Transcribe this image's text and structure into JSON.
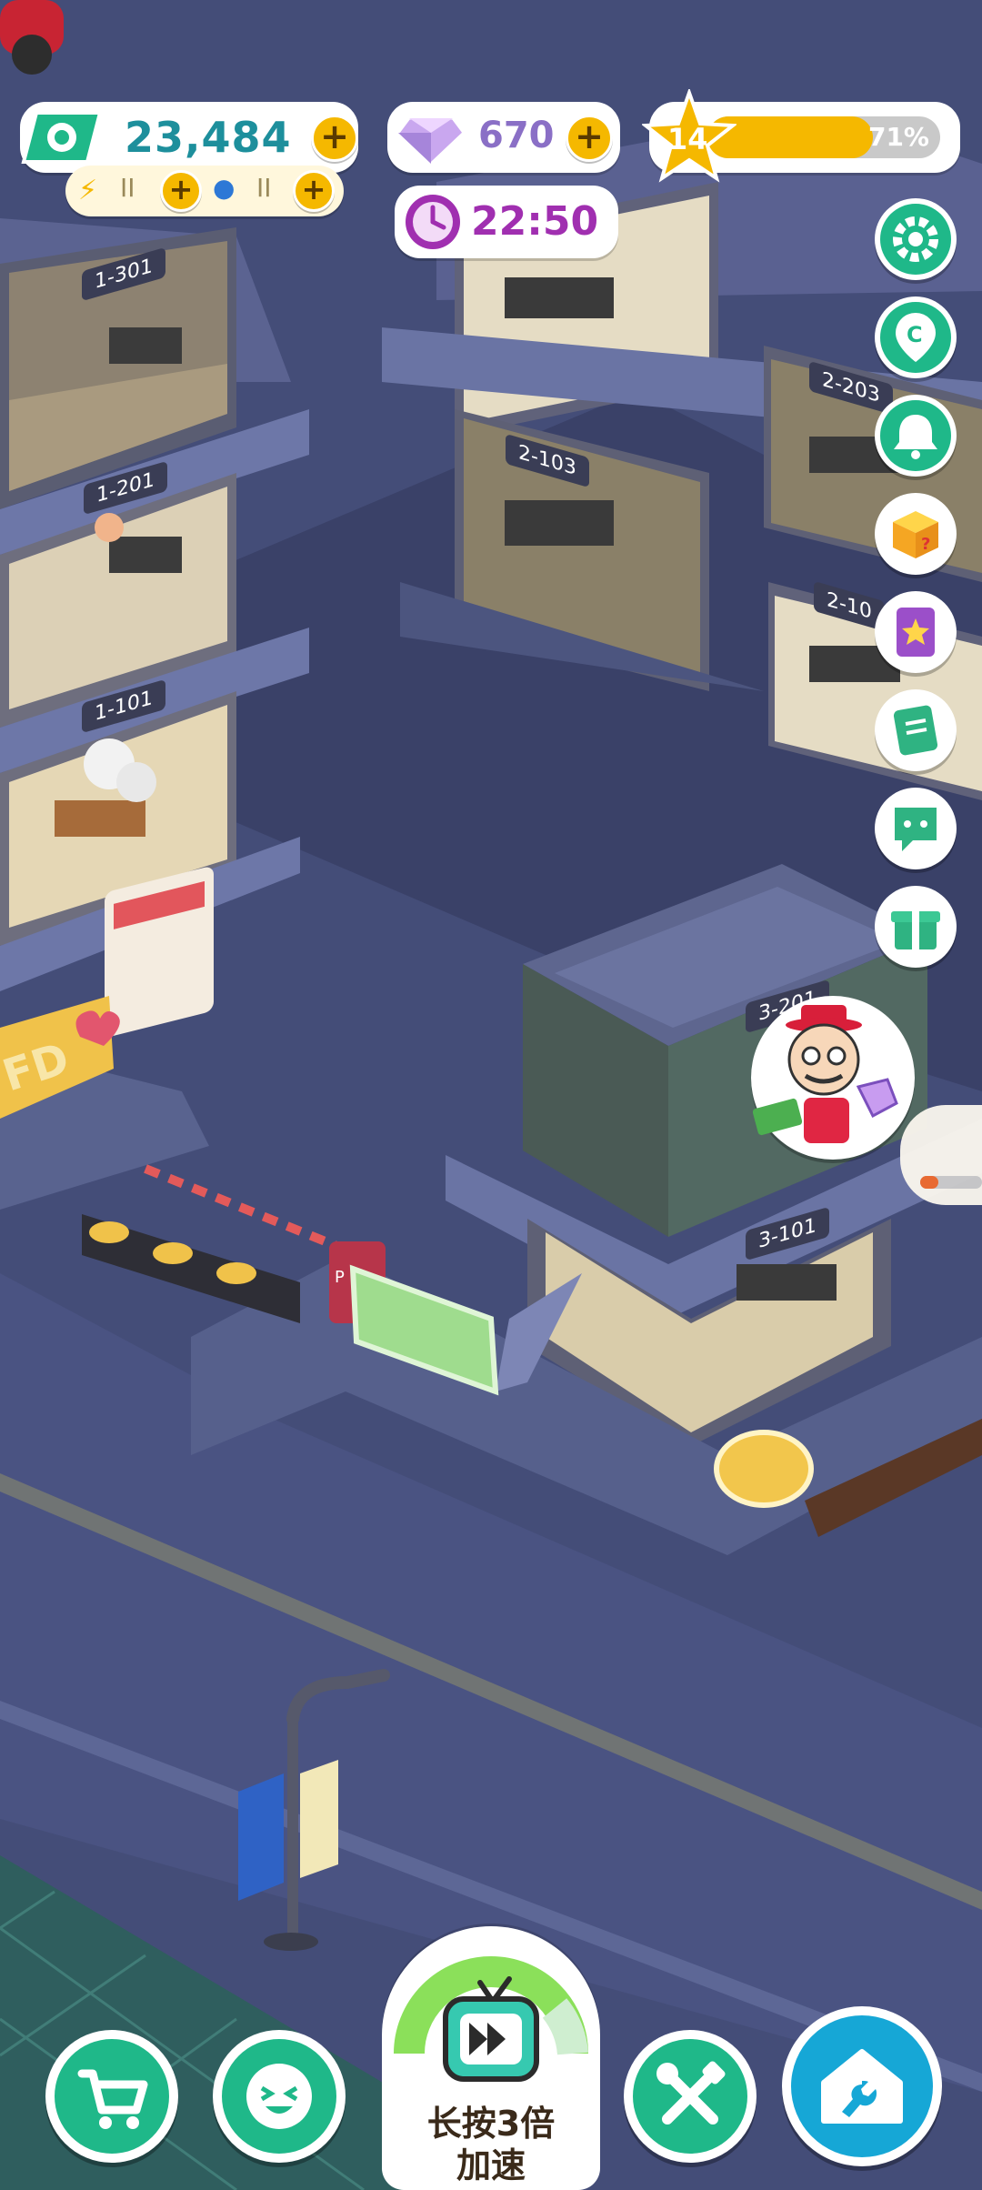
{
  "hud": {
    "cash": "23,484",
    "gems": "670",
    "level": "14",
    "level_progress_text": "71%",
    "level_progress": 0.71,
    "clock": "22:50",
    "energy_bar_text": "II",
    "water_bar_text": "II"
  },
  "rooms": {
    "r1_301": "1-301",
    "r1_201": "1-201",
    "r1_101": "1-101",
    "r2_103": "2-103",
    "r2_203": "2-203",
    "r2_10x": "2-10",
    "r3_201": "3-201",
    "r3_101": "3-101"
  },
  "signs": {
    "billboard": "FD",
    "parking": "P"
  },
  "speed_button": {
    "line1": "长按3倍",
    "line2": "加速"
  },
  "side_icons": [
    "gear-icon",
    "c-pin-icon",
    "bell-icon",
    "mystery-box-icon",
    "star-book-icon",
    "notes-icon",
    "chat-face-icon",
    "gift-icon"
  ],
  "bottom_icons": [
    "cart-icon",
    "laughing-face-icon",
    "tools-icon",
    "house-icon"
  ],
  "colors": {
    "accent_green": "#1fb889",
    "gold": "#f5b800",
    "gem_purple": "#8a6fc6",
    "clock_purple": "#a02fb0",
    "night_blue": "#3d4670"
  }
}
